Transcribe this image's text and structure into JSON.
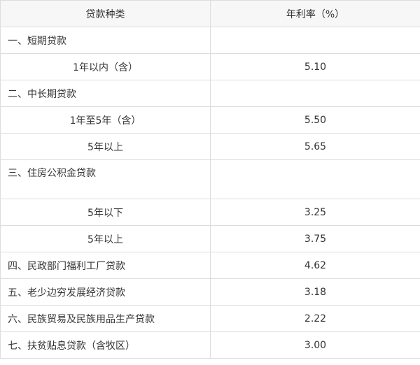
{
  "table": {
    "headers": [
      "贷款种类",
      "年利率（%）"
    ],
    "rows": [
      {
        "type": "section",
        "label": "一、短期贷款",
        "rate": ""
      },
      {
        "type": "sub",
        "label": "1年以内（含）",
        "rate": "5.10"
      },
      {
        "type": "section",
        "label": "二、中长期贷款",
        "rate": ""
      },
      {
        "type": "sub",
        "label": "1年至5年（含）",
        "rate": "5.50"
      },
      {
        "type": "sub",
        "label": "5年以上",
        "rate": "5.65"
      },
      {
        "type": "section-tall",
        "label": "三、住房公积金贷款",
        "rate": ""
      },
      {
        "type": "sub",
        "label": "5年以下",
        "rate": "3.25"
      },
      {
        "type": "sub",
        "label": "5年以上",
        "rate": "3.75"
      },
      {
        "type": "section",
        "label": "四、民政部门福利工厂贷款",
        "rate": "4.62"
      },
      {
        "type": "section",
        "label": "五、老少边穷发展经济贷款",
        "rate": "3.18"
      },
      {
        "type": "section",
        "label": "六、民族贸易及民族用品生产贷款",
        "rate": "2.22"
      },
      {
        "type": "section",
        "label": "七、扶贫贴息贷款（含牧区）",
        "rate": "3.00"
      }
    ]
  }
}
